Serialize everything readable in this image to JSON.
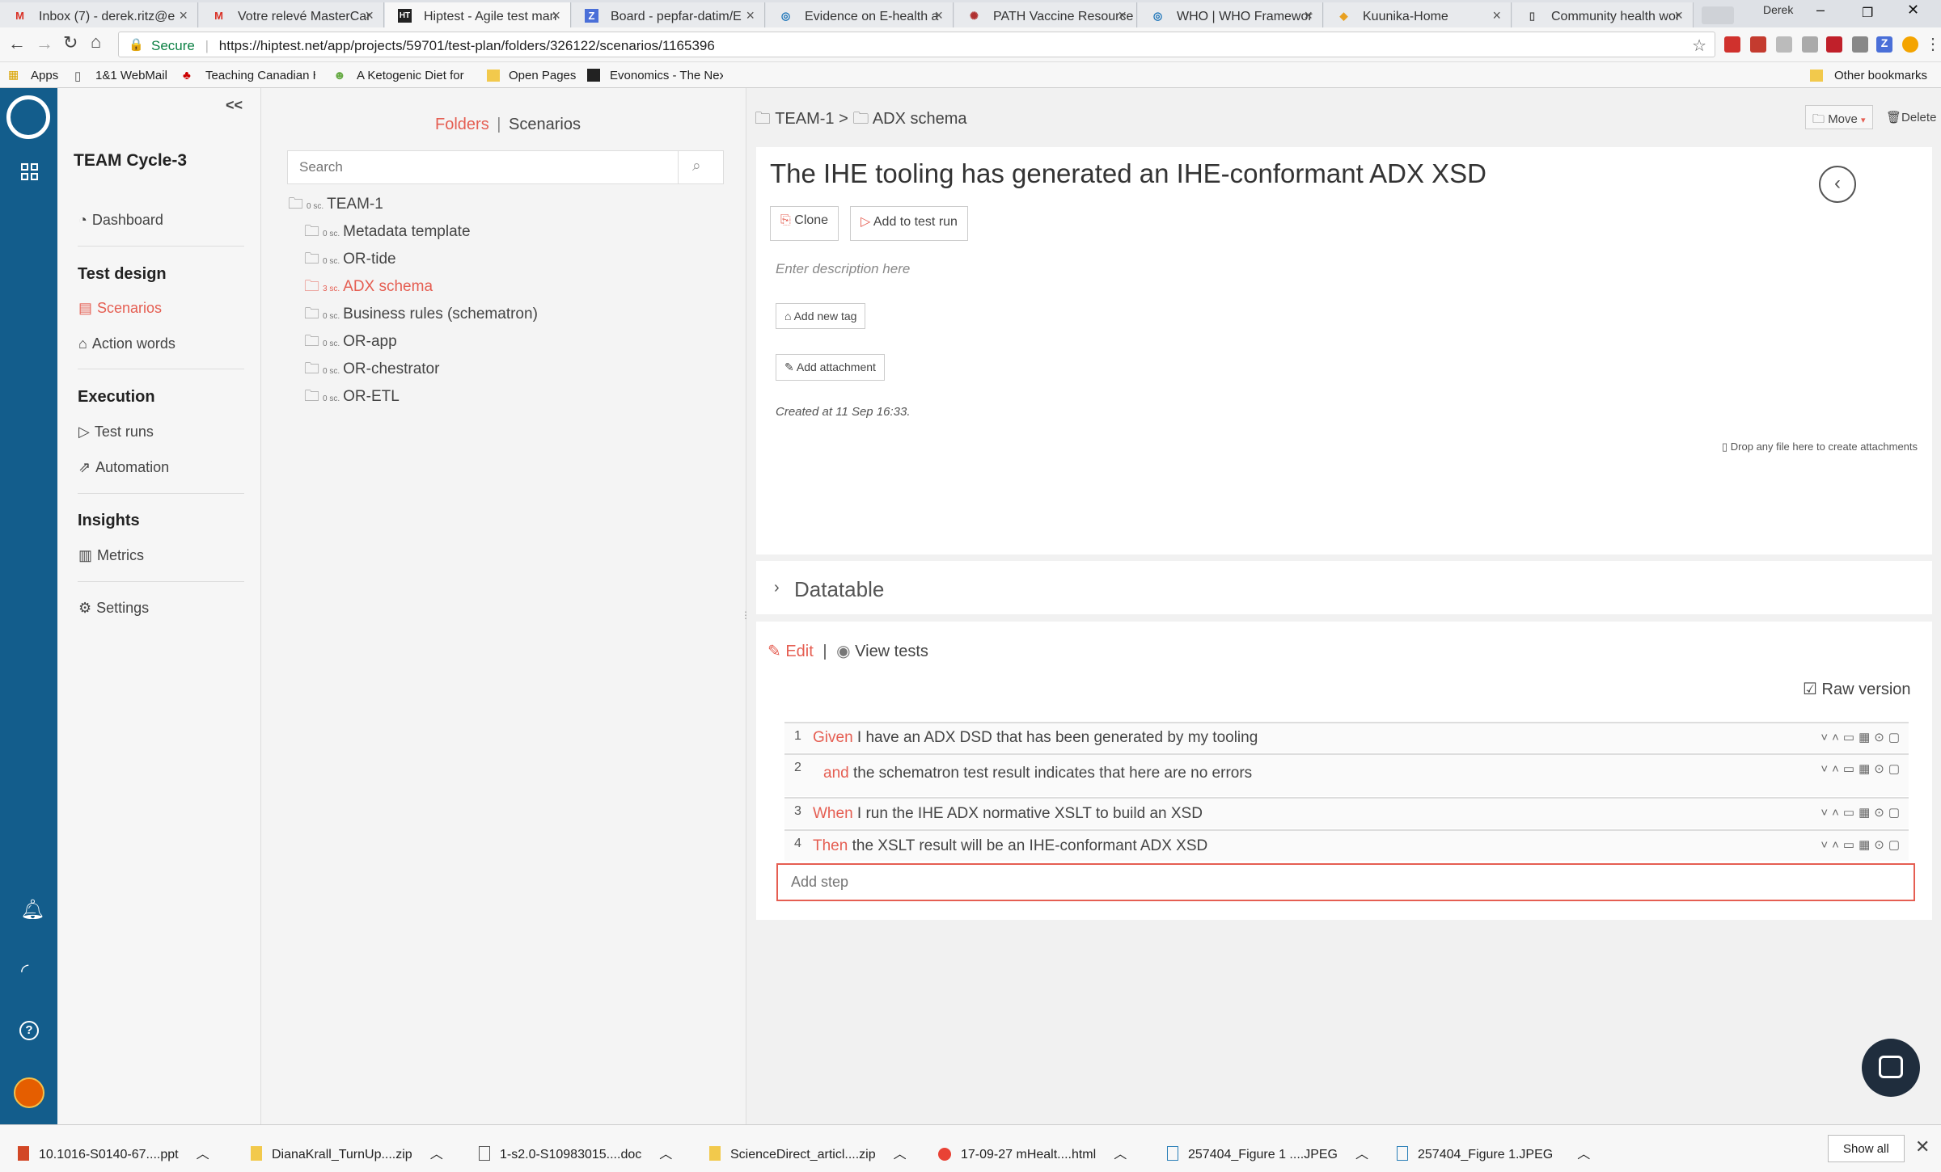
{
  "browser": {
    "tabs": [
      {
        "label": "Inbox (7) - derek.ritz@e",
        "icon": "gmail-icon"
      },
      {
        "label": "Votre relevé MasterCar",
        "icon": "gmail-icon"
      },
      {
        "label": "Hiptest - Agile test man",
        "icon": "hiptest-icon"
      },
      {
        "label": "Board - pepfar-datim/E",
        "icon": "zenhub-icon"
      },
      {
        "label": "Evidence on E-health a",
        "icon": "who-icon"
      },
      {
        "label": "PATH Vaccine Resource",
        "icon": "path-icon"
      },
      {
        "label": "WHO | WHO Framewor",
        "icon": "who-icon"
      },
      {
        "label": "Kuunika-Home",
        "icon": "kuunika-icon"
      },
      {
        "label": "Community health wor",
        "icon": "page-icon"
      }
    ],
    "profile": "Derek",
    "secure_label": "Secure",
    "url": "https://hiptest.net/app/projects/59701/test-plan/folders/326122/scenarios/1165396",
    "bookmarks": [
      "Apps",
      "1&1 WebMail",
      "Teaching Canadian H",
      "A Ketogenic Diet for",
      "Open Pages",
      "Evonomics - The Nex"
    ],
    "other_bookmarks": "Other bookmarks"
  },
  "sidebar": {
    "collapse": "<<",
    "project": "TEAM Cycle-3",
    "dashboard": "Dashboard",
    "test_design": "Test design",
    "scenarios": "Scenarios",
    "action_words": "Action words",
    "execution": "Execution",
    "test_runs": "Test runs",
    "automation": "Automation",
    "insights": "Insights",
    "metrics": "Metrics",
    "settings": "Settings"
  },
  "tree": {
    "tab_folders": "Folders",
    "tab_scenarios": "Scenarios",
    "search_placeholder": "Search",
    "root": {
      "count": "0 sc.",
      "label": "TEAM-1"
    },
    "items": [
      {
        "count": "0 sc.",
        "label": "Metadata template"
      },
      {
        "count": "0 sc.",
        "label": "OR-tide"
      },
      {
        "count": "3 sc.",
        "label": "ADX schema"
      },
      {
        "count": "0 sc.",
        "label": "Business rules (schematron)"
      },
      {
        "count": "0 sc.",
        "label": "OR-app"
      },
      {
        "count": "0 sc.",
        "label": "OR-chestrator"
      },
      {
        "count": "0 sc.",
        "label": "OR-ETL"
      }
    ]
  },
  "scenario": {
    "breadcrumb_root": "TEAM-1",
    "breadcrumb_sep": ">",
    "breadcrumb_folder": "ADX schema",
    "move": "Move",
    "delete": "Delete",
    "title": "The IHE tooling has generated an IHE-conformant ADX XSD",
    "clone": "Clone",
    "add_to_run": "Add to test run",
    "description_placeholder": "Enter description here",
    "add_tag": "Add new tag",
    "add_attachment": "Add attachment",
    "created": "Created at 11 Sep 16:33.",
    "drop_hint": "Drop any file here to create attachments",
    "datatable": "Datatable",
    "edit": "Edit",
    "view_tests": "View tests",
    "raw_version": "Raw version",
    "steps": [
      {
        "n": "1",
        "kw": "Given",
        "text": "I have an ADX DSD that has been generated by my tooling"
      },
      {
        "n": "2",
        "kw": "and",
        "text": "the schematron test result indicates that here are no errors"
      },
      {
        "n": "3",
        "kw": "When",
        "text": "I run the IHE ADX normative XSLT to build an XSD"
      },
      {
        "n": "4",
        "kw": "Then",
        "text": "the XSLT result will be an IHE-conformant ADX XSD"
      }
    ],
    "add_step_placeholder": "Add step"
  },
  "downloads": {
    "items": [
      "10.1016-S0140-67....ppt",
      "DianaKrall_TurnUp....zip",
      "1-s2.0-S10983015....doc",
      "ScienceDirect_articl....zip",
      "17-09-27 mHealt....html",
      "257404_Figure 1 ....JPEG",
      "257404_Figure 1.JPEG"
    ],
    "show_all": "Show all"
  },
  "colors": {
    "accent": "#e55e52",
    "rail": "#135d8c",
    "link": "#2a7fb8"
  }
}
